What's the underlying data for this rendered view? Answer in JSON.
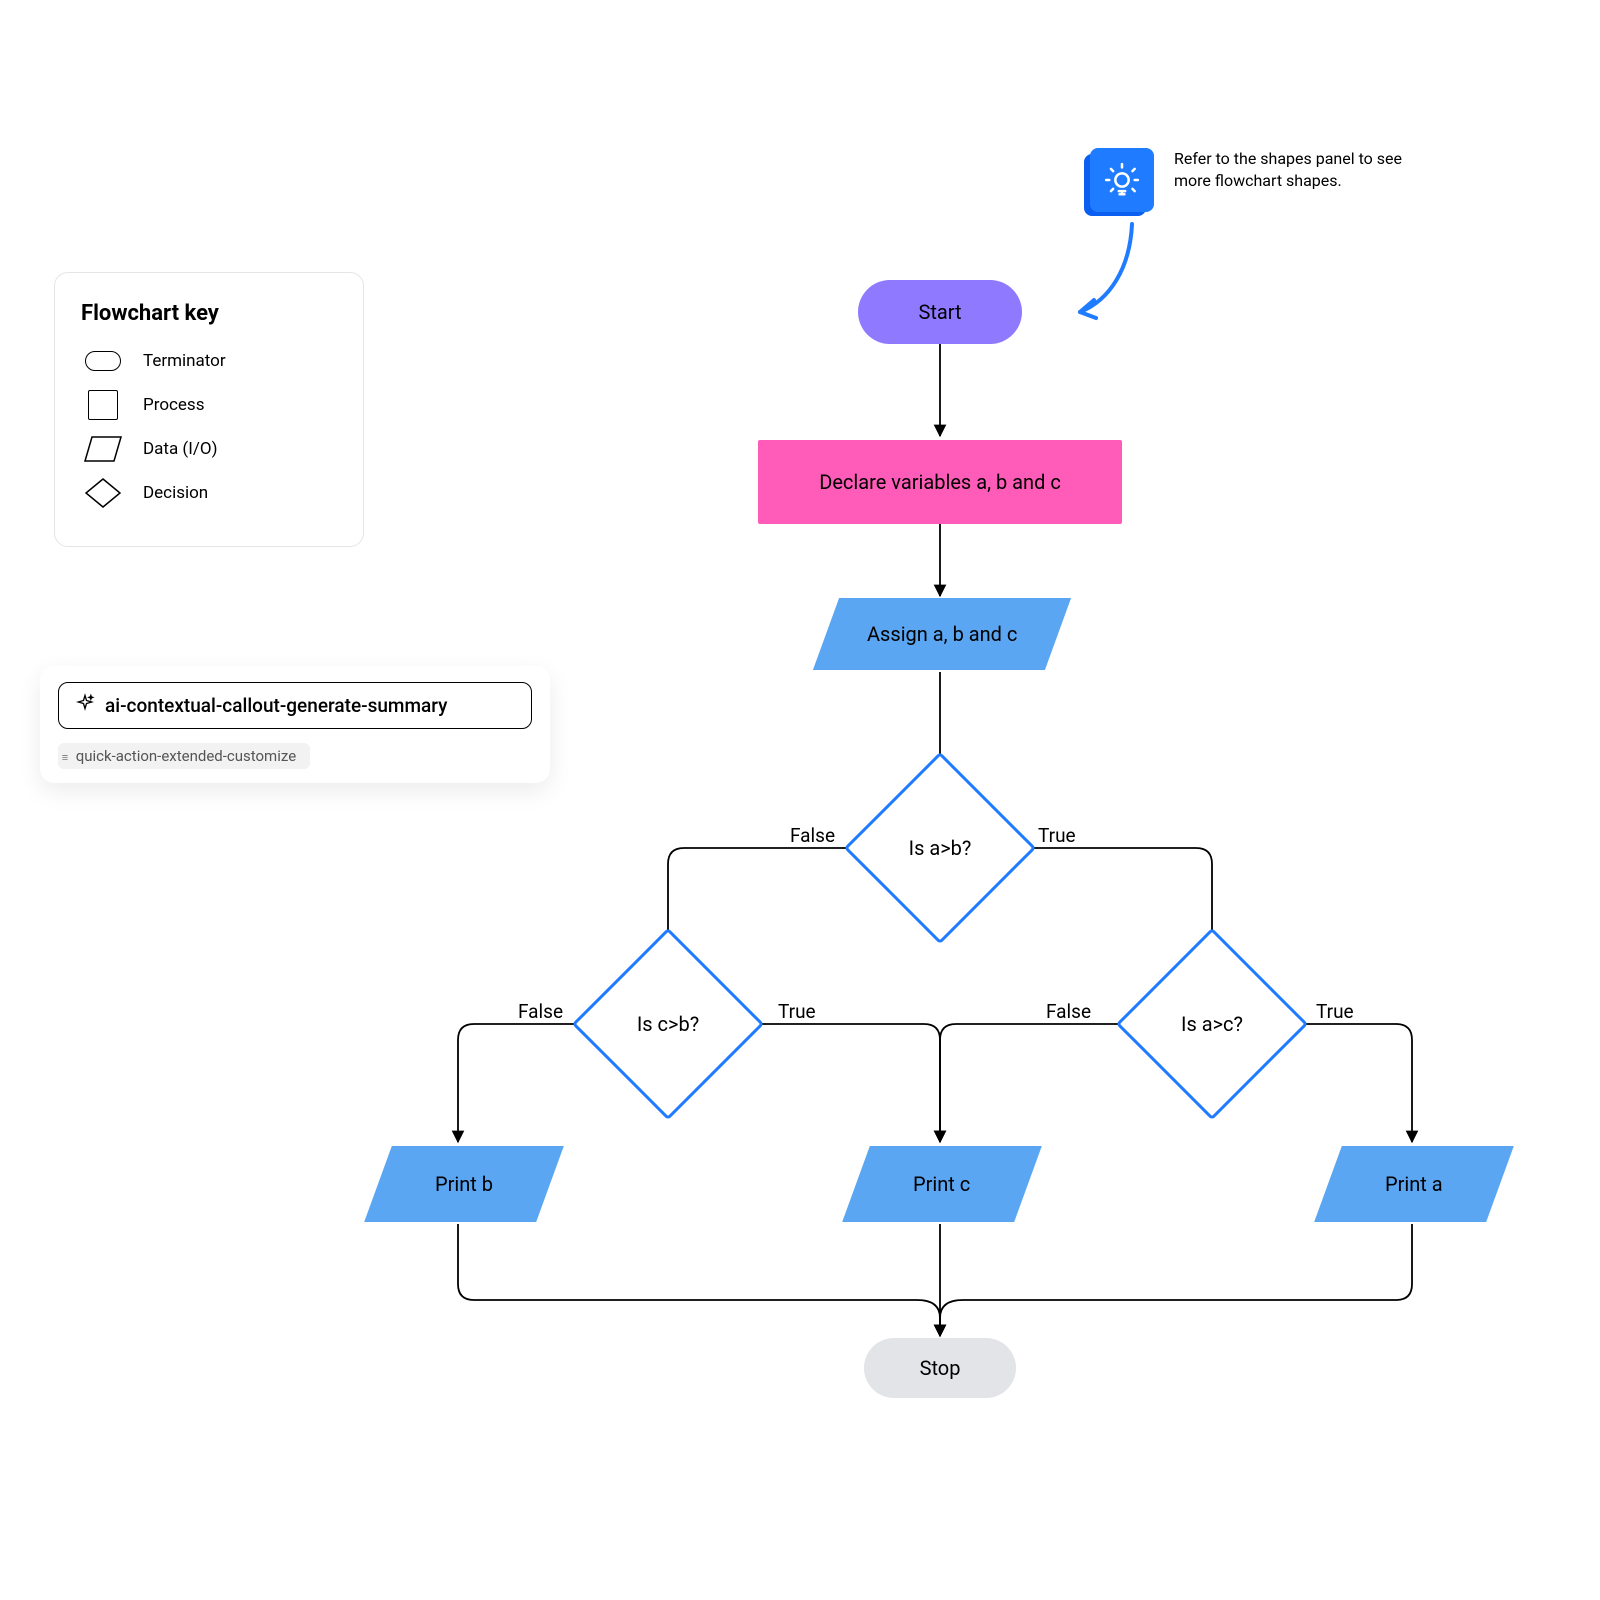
{
  "key": {
    "title": "Flowchart key",
    "items": [
      {
        "label": "Terminator"
      },
      {
        "label": "Process"
      },
      {
        "label": "Data (I/O)"
      },
      {
        "label": "Decision"
      }
    ]
  },
  "ai": {
    "button_label": "ai-contextual-callout-generate-summary",
    "sub_label": "quick-action-extended-customize"
  },
  "hint": {
    "text": "Refer to the shapes panel to see more flowchart shapes."
  },
  "nodes": {
    "start": "Start",
    "declare": "Declare variables a, b and c",
    "assign": "Assign a, b and c",
    "d1": "Is a>b?",
    "d2": "Is c>b?",
    "d3": "Is a>c?",
    "pb": "Print b",
    "pc": "Print c",
    "pa": "Print a",
    "stop": "Stop"
  },
  "labels": {
    "t": "True",
    "f": "False"
  }
}
